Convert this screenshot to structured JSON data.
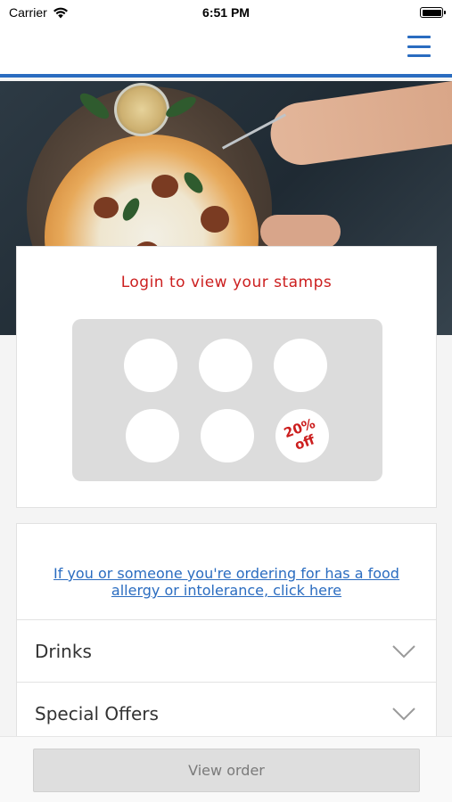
{
  "status_bar": {
    "carrier": "Carrier",
    "time": "6:51 PM"
  },
  "header": {
    "menu_icon": "hamburger-menu-icon",
    "accent_color": "#2a6cc0"
  },
  "hero": {
    "image": "pizza-photo"
  },
  "stamps": {
    "title": "Login to view your stamps",
    "title_color": "#cc1f1f",
    "total": 6,
    "collected": 0,
    "reward_line1": "20%",
    "reward_line2": "off"
  },
  "allergy": {
    "link_text": "If you or someone you're ordering for has a food allergy or intolerance, click here"
  },
  "categories": [
    {
      "label": "Drinks",
      "icon": "chevron-down-icon"
    },
    {
      "label": "Special Offers",
      "icon": "chevron-down-icon"
    }
  ],
  "footer": {
    "view_order_label": "View order"
  }
}
